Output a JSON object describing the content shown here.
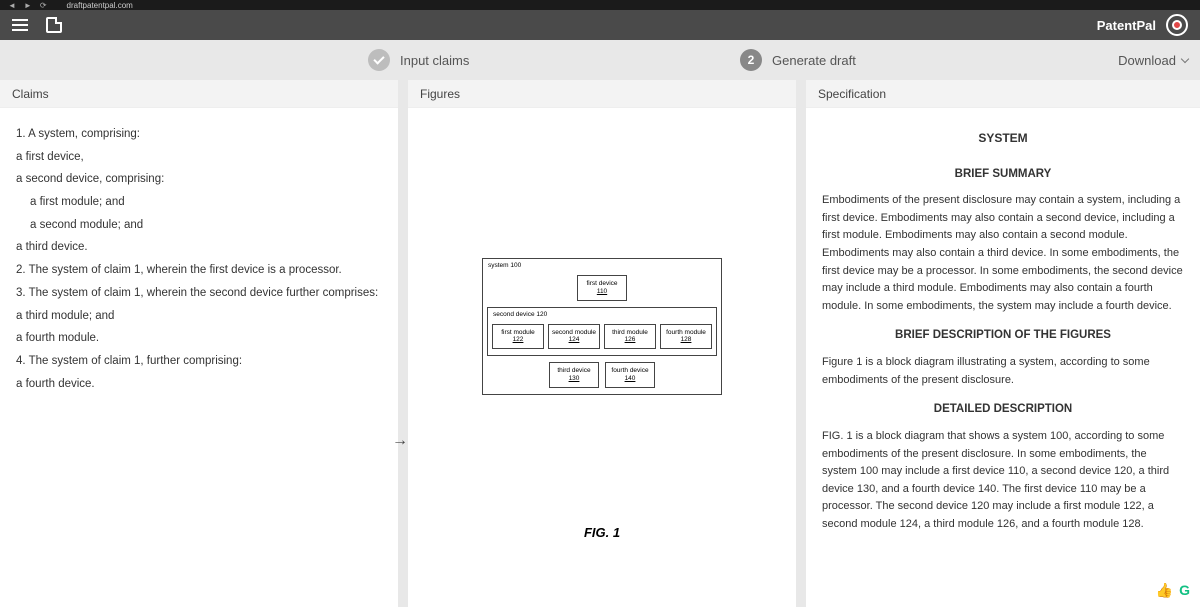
{
  "browser": {
    "url": "draftpatentpal.com"
  },
  "header": {
    "brand": "PatentPal"
  },
  "stepper": {
    "step1_label": "Input claims",
    "step2_num": "2",
    "step2_label": "Generate draft",
    "download": "Download"
  },
  "panels": {
    "claims_title": "Claims",
    "figures_title": "Figures",
    "spec_title": "Specification"
  },
  "claims": {
    "c1": "1. A system, comprising:",
    "c1a": "a first device,",
    "c1b": "a second device, comprising:",
    "c1b1": "a first module; and",
    "c1b2": "a second module; and",
    "c1c": "a third device.",
    "c2": "2. The system of claim 1, wherein the first device is a processor.",
    "c3": "3. The system of claim 1, wherein the second device further comprises:",
    "c3a": "a third module; and",
    "c3b": "a fourth module.",
    "c4": "4. The system of claim 1, further comprising:",
    "c4a": "a fourth device."
  },
  "figure": {
    "system_label": "system 100",
    "first_device": "first device",
    "first_device_num": "110",
    "second_device_label": "second device 120",
    "first_module": "first module",
    "first_module_num": "122",
    "second_module": "second module",
    "second_module_num": "124",
    "third_module": "third module",
    "third_module_num": "126",
    "fourth_module": "fourth module",
    "fourth_module_num": "128",
    "third_device": "third device",
    "third_device_num": "130",
    "fourth_device": "fourth device",
    "fourth_device_num": "140",
    "caption": "FIG. 1"
  },
  "spec": {
    "doc_title": "SYSTEM",
    "summary_title": "BRIEF SUMMARY",
    "summary_text": "Embodiments of the present disclosure may contain a system, including a first device. Embodiments may also contain a second device, including a first module. Embodiments may also contain a second module. Embodiments may also contain a third device. In some embodiments, the first device may be a processor. In some embodiments, the second device may include a third module. Embodiments may also contain a fourth module. In some embodiments, the system may include a fourth device.",
    "figs_title": "BRIEF DESCRIPTION OF THE FIGURES",
    "figs_text": "Figure 1 is a block diagram illustrating a system, according to some embodiments of the present disclosure.",
    "detail_title": "DETAILED DESCRIPTION",
    "detail_text": "FIG. 1 is a block diagram that shows a system 100, according to some embodiments of the present disclosure. In some embodiments, the system 100 may include a first device 110, a second device 120, a third device 130, and a fourth device 140. The first device 110 may be a processor. The second device 120 may include a first module 122, a second module 124, a third module 126, and a fourth module 128."
  }
}
